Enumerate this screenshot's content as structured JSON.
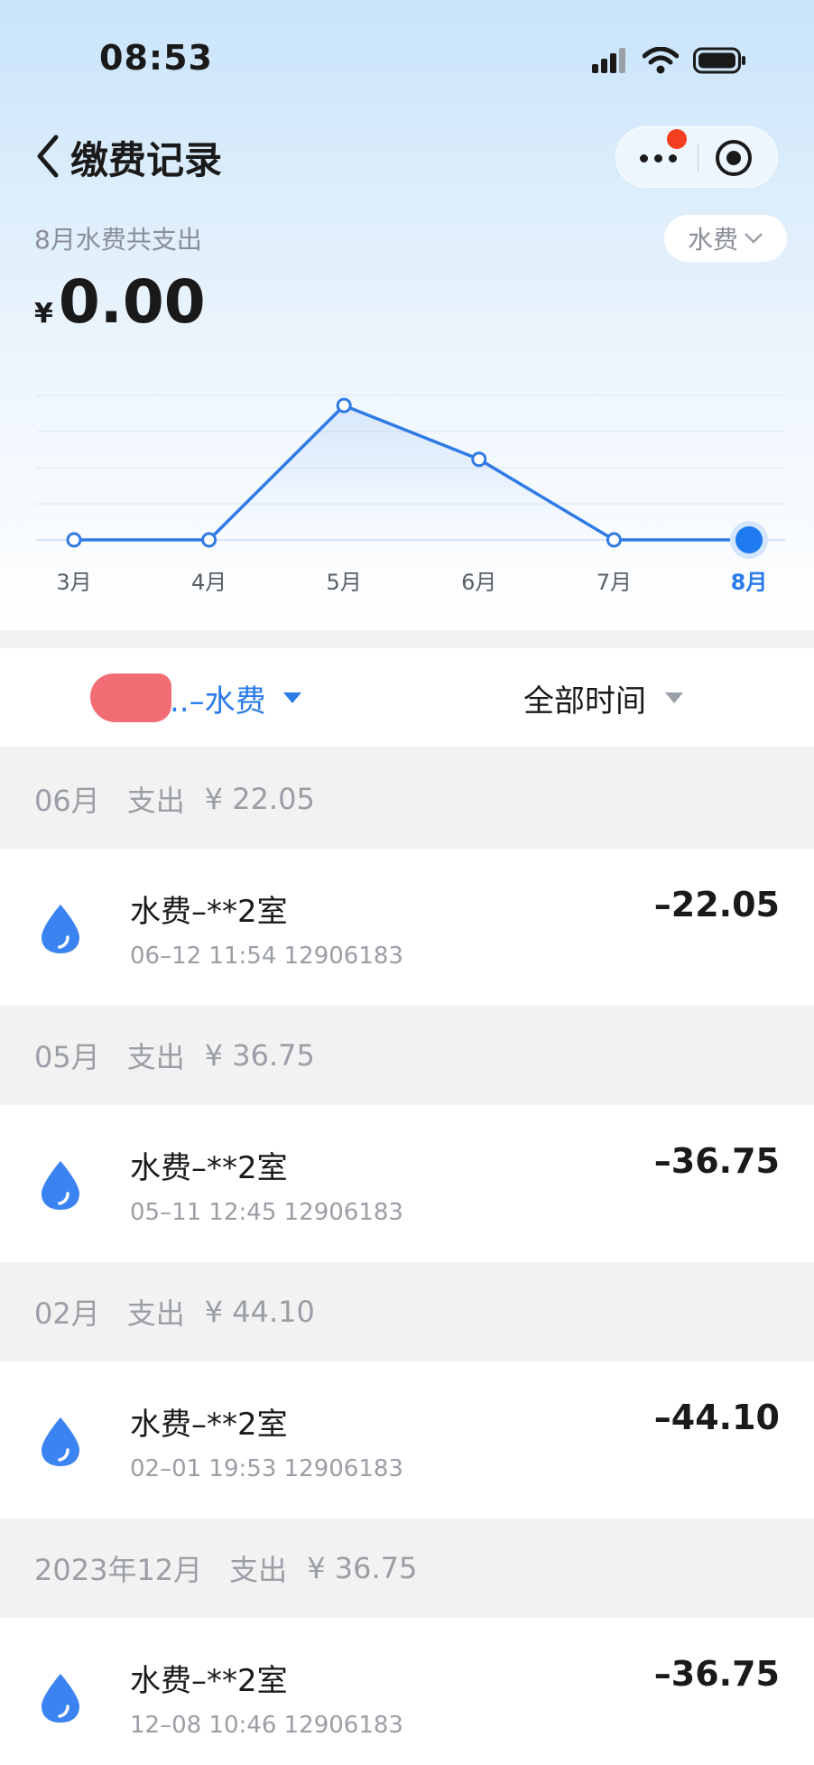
{
  "status_bar": {
    "time": "08:53"
  },
  "nav": {
    "title": "缴费记录"
  },
  "summary": {
    "label": "8月水费共支出",
    "currency": "¥",
    "amount": "0.00",
    "type_filter": "水费"
  },
  "chart_data": {
    "type": "line",
    "categories": [
      "3月",
      "4月",
      "5月",
      "6月",
      "7月",
      "8月"
    ],
    "values": [
      0,
      0,
      36.75,
      22.05,
      0,
      0
    ],
    "selected": "8月",
    "ylim": [
      0,
      40
    ],
    "grid": true,
    "colors": {
      "line": "#2f7ae5",
      "selected_point": "#1f7af0",
      "label": "#5a5f66",
      "selected_label": "#2b7be8"
    }
  },
  "filters": {
    "account_label": "..–水费",
    "time_label": "全部时间"
  },
  "sections": [
    {
      "month": "06月",
      "spend_label": "支出",
      "sum": "¥ 22.05",
      "record": {
        "name": "水费–**2室",
        "meta": "06–12 11:54 12906183",
        "amount": "–22.05"
      }
    },
    {
      "month": "05月",
      "spend_label": "支出",
      "sum": "¥ 36.75",
      "record": {
        "name": "水费–**2室",
        "meta": "05–11 12:45 12906183",
        "amount": "–36.75"
      }
    },
    {
      "month": "02月",
      "spend_label": "支出",
      "sum": "¥ 44.10",
      "record": {
        "name": "水费–**2室",
        "meta": "02–01 19:53 12906183",
        "amount": "–44.10"
      }
    },
    {
      "month": "2023年12月",
      "spend_label": "支出",
      "sum": "¥ 36.75",
      "record": {
        "name": "水费–**2室",
        "meta": "12–08 10:46 12906183",
        "amount": "–36.75"
      }
    }
  ],
  "icons": {
    "water": "water-drop-icon",
    "back": "chevron-left-icon",
    "more": "more-dots-icon",
    "close": "target-circle-icon"
  },
  "colors": {
    "accent": "#2b7be8",
    "drop": "#3a83f0"
  }
}
